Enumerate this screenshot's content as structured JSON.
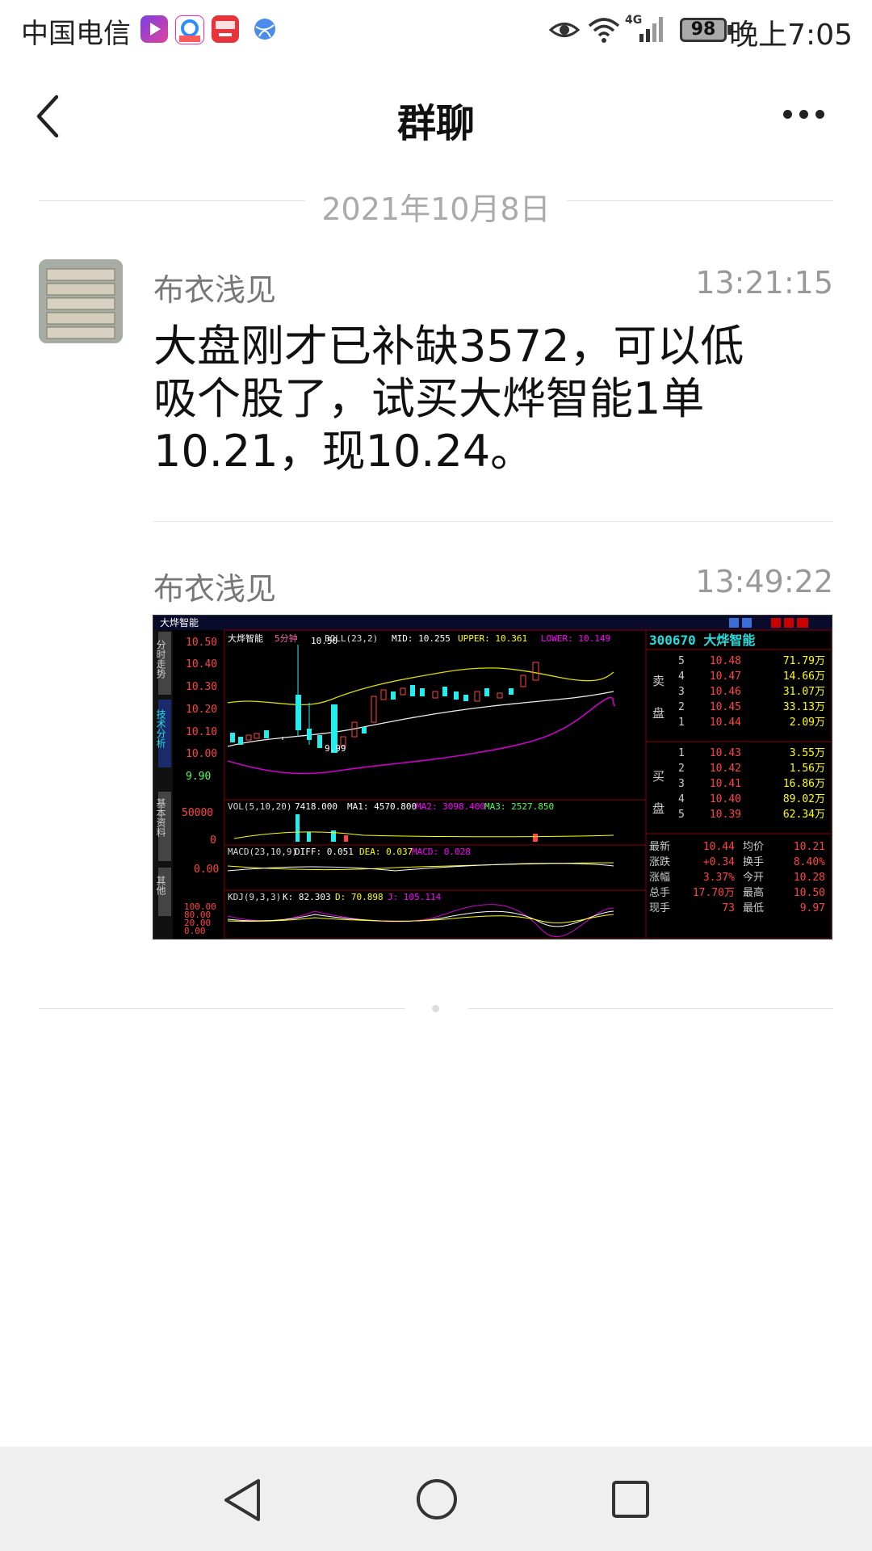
{
  "status_bar": {
    "carrier": "中国电信",
    "time": "晚上7:05",
    "battery": "98",
    "network": "4G",
    "icons": [
      "video-app-icon",
      "browser-app-icon",
      "pay-app-icon",
      "globe-app-icon",
      "eye-icon",
      "wifi-icon",
      "signal-icon",
      "battery-icon"
    ]
  },
  "nav": {
    "title": "群聊",
    "back_icon": "back-icon",
    "more_icon": "more-icon"
  },
  "date_separator": "2021年10月8日",
  "messages": [
    {
      "sender": "布衣浅见",
      "time": "13:21:15",
      "text_lines": [
        "大盘刚才已补缺3572，可以低",
        "吸个股了，试买大烨智能1单",
        "10.21，现10.24。"
      ]
    },
    {
      "sender": "布衣浅见",
      "time": "13:49:22",
      "image": "stock-chart-screenshot"
    }
  ],
  "chart_image": {
    "window_title": "大烨智能",
    "side_tabs": [
      "分时走势",
      "技术分析",
      "基本资料",
      "其他"
    ],
    "main_header": [
      "大烨智能",
      "5分钟",
      "BOLL(23,2)",
      "MID: 10.255",
      "UPPER: 10.361",
      "LOWER: 10.149"
    ],
    "price_ticks": [
      "10.50",
      "10.40",
      "10.30",
      "10.20",
      "10.10",
      "10.00",
      "9.90"
    ],
    "peak_label": "10.50",
    "low_label": "9.99",
    "vol_header": [
      "VOL(5,10,20)",
      "7418.000",
      "MA1: 4570.800",
      "MA2: 3098.400",
      "MA3: 2527.850"
    ],
    "vol_ticks": [
      "50000",
      "0"
    ],
    "macd_header": [
      "MACD(23,10,9)",
      "DIFF: 0.051",
      "DEA: 0.037",
      "MACD: 0.028"
    ],
    "macd_tick": "0.00",
    "kdj_header": [
      "KDJ(9,3,3)",
      "K: 82.303",
      "D: 70.898",
      "J: 105.114"
    ],
    "kdj_ticks": [
      "100.00",
      "80.00",
      "20.00",
      "0.00"
    ],
    "code_title": "300670 大烨智能",
    "sell_label": [
      "卖",
      "盘"
    ],
    "buy_label": [
      "买",
      "盘"
    ],
    "sell_rows": [
      {
        "n": "5",
        "p": "10.48",
        "v": "71.79万"
      },
      {
        "n": "4",
        "p": "10.47",
        "v": "14.66万"
      },
      {
        "n": "3",
        "p": "10.46",
        "v": "31.07万"
      },
      {
        "n": "2",
        "p": "10.45",
        "v": "33.13万"
      },
      {
        "n": "1",
        "p": "10.44",
        "v": "2.09万"
      }
    ],
    "buy_rows": [
      {
        "n": "1",
        "p": "10.43",
        "v": "3.55万"
      },
      {
        "n": "2",
        "p": "10.42",
        "v": "1.56万"
      },
      {
        "n": "3",
        "p": "10.41",
        "v": "16.86万"
      },
      {
        "n": "4",
        "p": "10.40",
        "v": "89.02万"
      },
      {
        "n": "5",
        "p": "10.39",
        "v": "62.34万"
      }
    ],
    "stats": [
      {
        "l1": "最新",
        "v1": "10.44",
        "l2": "均价",
        "v2": "10.21"
      },
      {
        "l1": "涨跌",
        "v1": "+0.34",
        "l2": "换手",
        "v2": "8.40%"
      },
      {
        "l1": "涨幅",
        "v1": "3.37%",
        "l2": "今开",
        "v2": "10.28"
      },
      {
        "l1": "总手",
        "v1": "17.70万",
        "l2": "最高",
        "v2": "10.50"
      },
      {
        "l1": "现手",
        "v1": "73",
        "l2": "最低",
        "v2": "9.97"
      }
    ]
  },
  "bottom_nav": [
    "back-triangle-icon",
    "home-circle-icon",
    "recents-square-icon"
  ]
}
